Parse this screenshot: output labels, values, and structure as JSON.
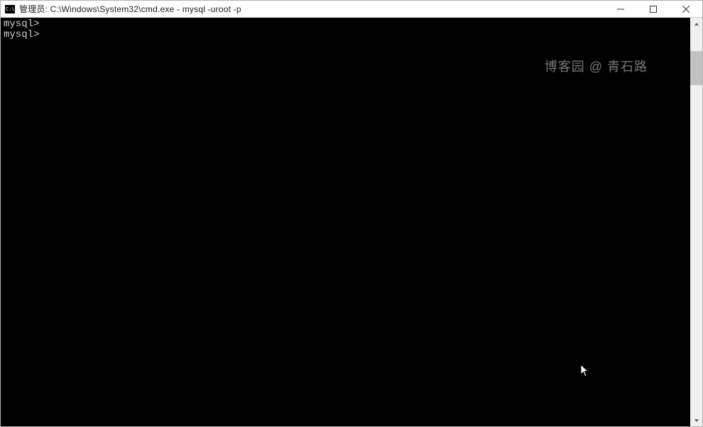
{
  "window": {
    "title": "管理员: C:\\Windows\\System32\\cmd.exe - mysql  -uroot -p"
  },
  "terminal": {
    "lines": [
      {
        "prompt": "mysql>",
        "text": ""
      },
      {
        "prompt": "mysql>",
        "text": ""
      }
    ]
  },
  "watermark": "博客园 @ 青石路",
  "colors": {
    "terminal_bg": "#000000",
    "terminal_fg": "#d0d0d0",
    "titlebar_bg": "#ffffff",
    "scrollbar_thumb": "#c2c2c2"
  }
}
